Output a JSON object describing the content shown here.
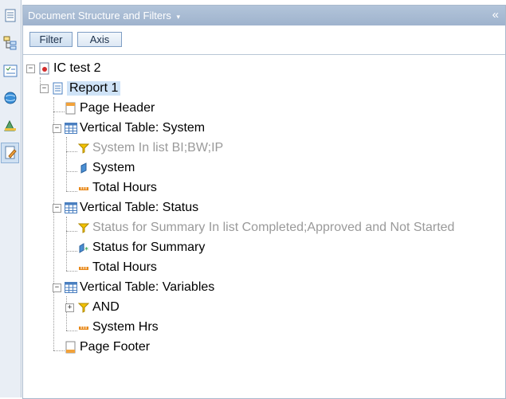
{
  "panel": {
    "title": "Document Structure and Filters",
    "title_arrow": "▾",
    "collapse": "«"
  },
  "tabs": [
    {
      "label": "Filter"
    },
    {
      "label": "Axis"
    }
  ],
  "tree": {
    "root": "IC test 2",
    "report": "Report 1",
    "page_header": "Page Header",
    "table_system": "Vertical Table: System",
    "filter_system": "System In list BI;BW;IP",
    "dim_system": "System",
    "measure_total_hours_1": "Total Hours",
    "table_status": "Vertical Table: Status",
    "filter_status": "Status for Summary In list Completed;Approved and Not Started",
    "dim_status": "Status for Summary",
    "measure_total_hours_2": "Total Hours",
    "table_variables": "Vertical Table: Variables",
    "filter_and": "AND",
    "measure_system_hrs": "System Hrs",
    "page_footer": "Page Footer"
  },
  "colors": {
    "header": "#a8bbd3",
    "selected": "#cfe3f7",
    "filter_icon": "#f2c200",
    "table_icon": "#4a7fc0",
    "measure_icon": "#e8891a"
  }
}
